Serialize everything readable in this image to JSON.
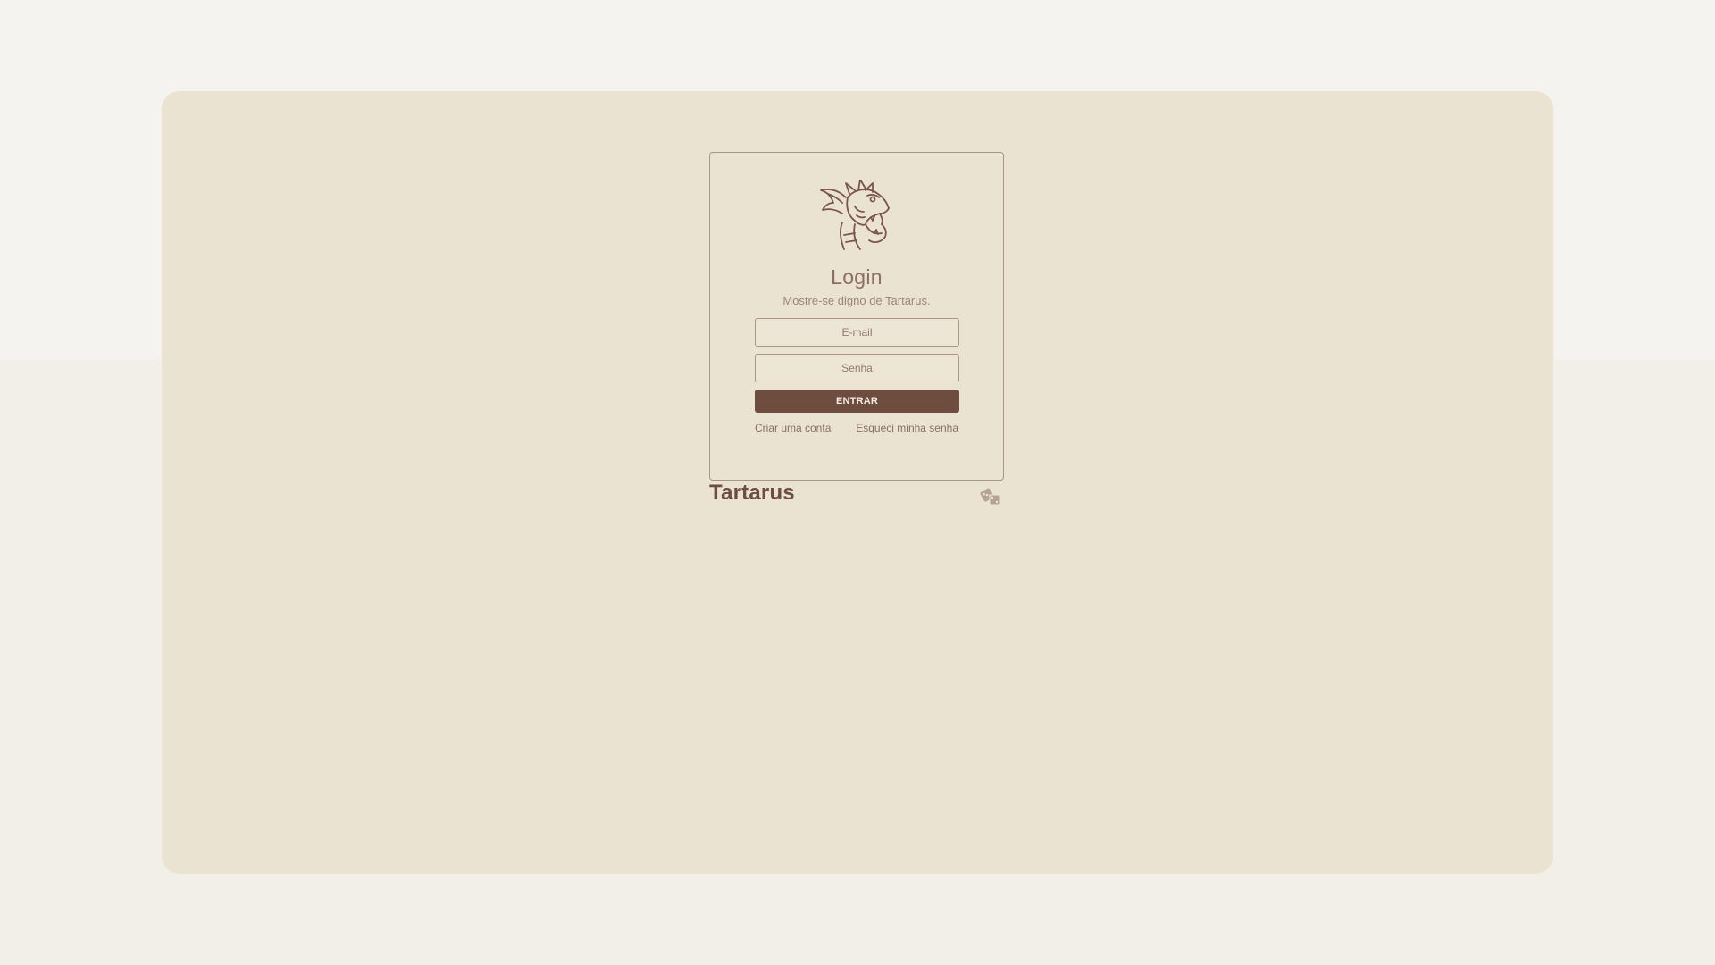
{
  "app": {
    "brand_name": "Tartarus"
  },
  "login": {
    "title": "Login",
    "subtitle": "Mostre-se digno de Tartarus.",
    "email_placeholder": "E-mail",
    "email_value": "",
    "password_placeholder": "Senha",
    "password_value": "",
    "submit_label": "ENTRAR",
    "create_account_label": "Criar uma conta",
    "forgot_password_label": "Esqueci minha senha"
  },
  "icons": {
    "logo": "dragon-head-icon",
    "dice": "dice-icon"
  },
  "colors": {
    "page_background": "#f5f3ef",
    "panel_background": "#ebe3d2",
    "accent": "#6e4c40",
    "border": "#a89686",
    "text": "#8a6f62"
  }
}
